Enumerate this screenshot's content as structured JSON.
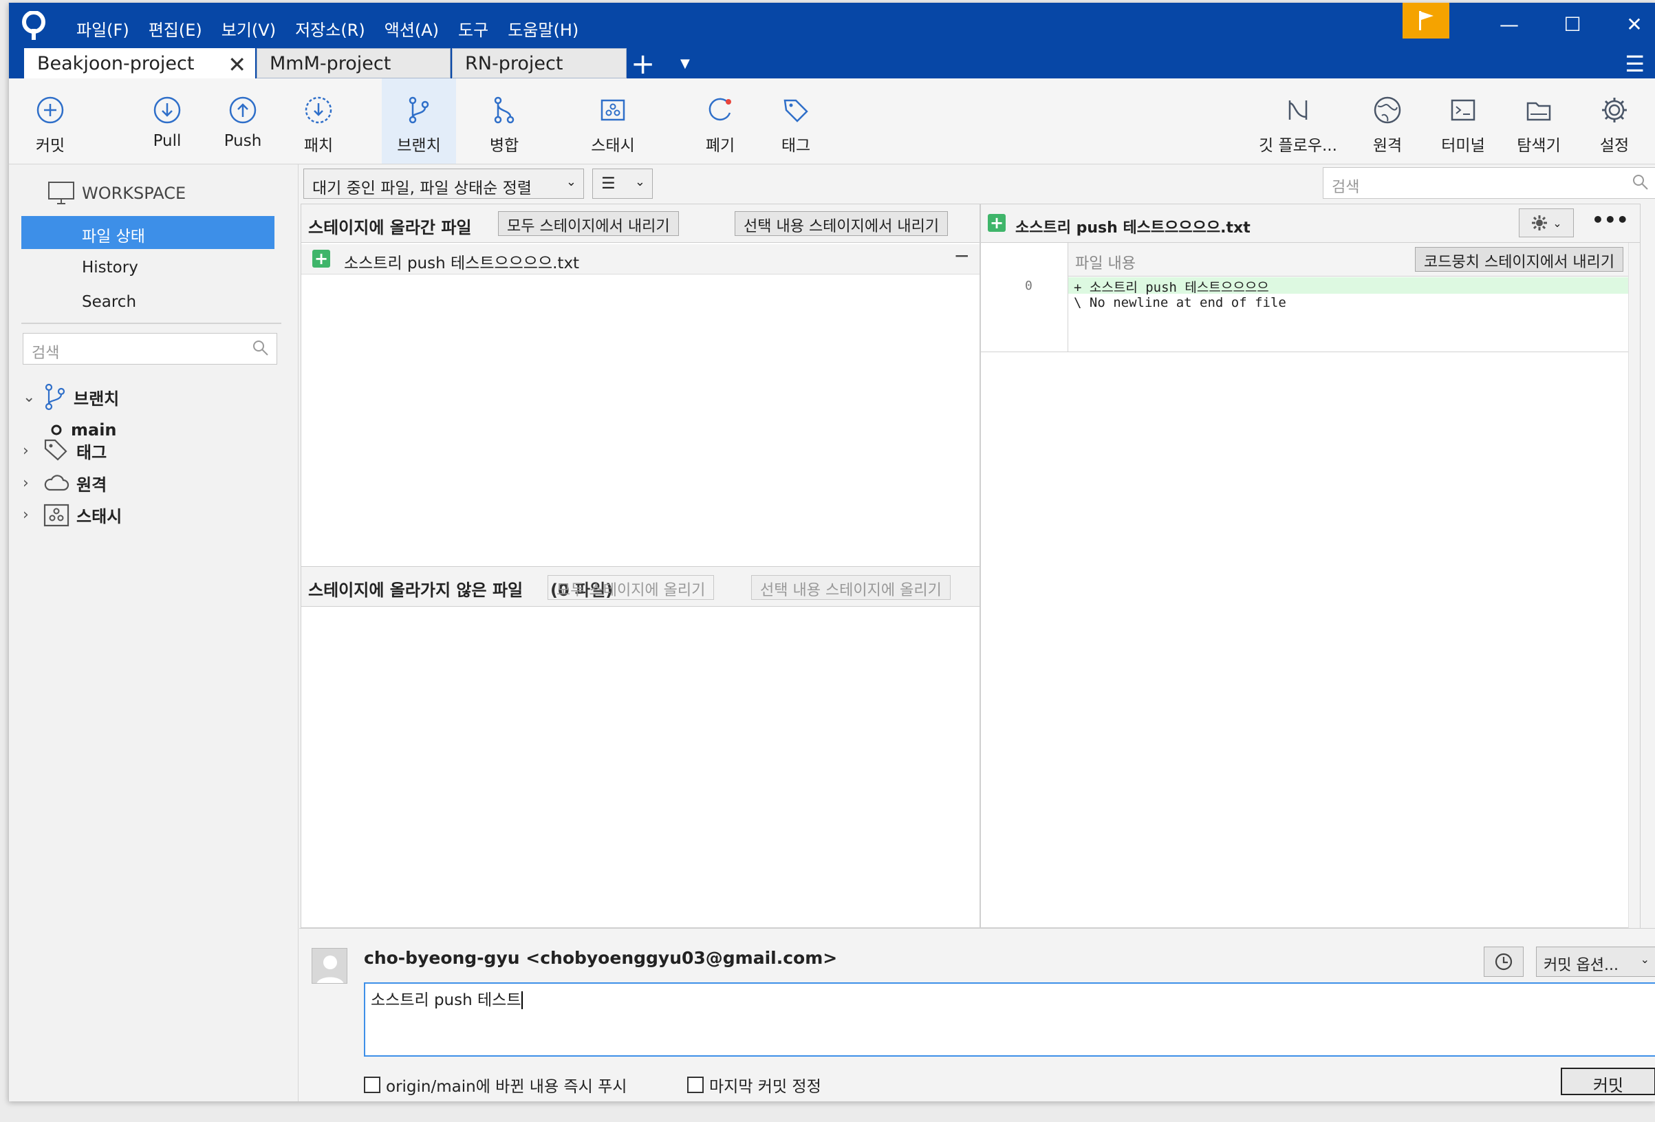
{
  "menu": [
    "파일(F)",
    "편집(E)",
    "보기(V)",
    "저장소(R)",
    "액션(A)",
    "도구",
    "도움말(H)"
  ],
  "window_controls": {
    "minimize": "—",
    "maximize": "☐",
    "close": "✕"
  },
  "tabs": [
    {
      "label": "Beakjoon-project",
      "active": true,
      "close": "✕"
    },
    {
      "label": "MmM-project",
      "active": false
    },
    {
      "label": "RN-project",
      "active": false
    }
  ],
  "tab_add": "+",
  "toolbar": {
    "commit": "커밋",
    "pull": "Pull",
    "push": "Push",
    "patch": "패치",
    "branch": "브랜치",
    "merge": "병합",
    "stash": "스태시",
    "discard": "폐기",
    "tag": "태그",
    "gitflow": "깃 플로우...",
    "remote": "원격",
    "terminal": "터미널",
    "explorer": "탐색기",
    "settings": "설정"
  },
  "sidebar": {
    "workspace": "WORKSPACE",
    "nav": [
      "파일 상태",
      "History",
      "Search"
    ],
    "search_placeholder": "검색",
    "branches_label": "브랜치",
    "branch_main": "main",
    "tags_label": "태그",
    "remotes_label": "원격",
    "stash_label": "스태시"
  },
  "filter": {
    "sort": "대기 중인 파일, 파일 상태순 정렬",
    "view": "☰",
    "search_placeholder": "검색"
  },
  "staged": {
    "title": "스테이지에 올라간 파일",
    "btn_unstage_all": "모두 스테이지에서 내리기",
    "btn_unstage_sel": "선택 내용 스테이지에서 내리기",
    "files": [
      "소스트리 push 테스트으으으으.txt"
    ]
  },
  "unstaged": {
    "title": "스테이지에 올라가지 않은 파일",
    "overlap": "(0 파일)",
    "btn_stage_all": "모두 스테이지에 올리기",
    "btn_stage_sel": "선택 내용 스테이지에 올리기"
  },
  "diff": {
    "filename": "소스트리 push 테스트으으으으.txt",
    "header": "파일 내용",
    "btn_unstage_hunk": "코드뭉치 스테이지에서 내리기",
    "line_no": "0",
    "added_line": "+ 소스트리 push 테스트으으으으",
    "meta_line": "\\  No newline at end of file"
  },
  "commit": {
    "author": "cho-byeong-gyu <chobyoenggyu03@gmail.com>",
    "message": "소스트리 push 테스트",
    "options": "커밋 옵션...",
    "push_now": "origin/main에 바뀐 내용 즉시 푸시",
    "amend": "마지막 커밋 정정",
    "submit": "커밋"
  },
  "colors": {
    "titlebar": "#0747a6",
    "accent": "#3d8fe8",
    "flag": "#f5a300",
    "added": "#3fb56a"
  }
}
